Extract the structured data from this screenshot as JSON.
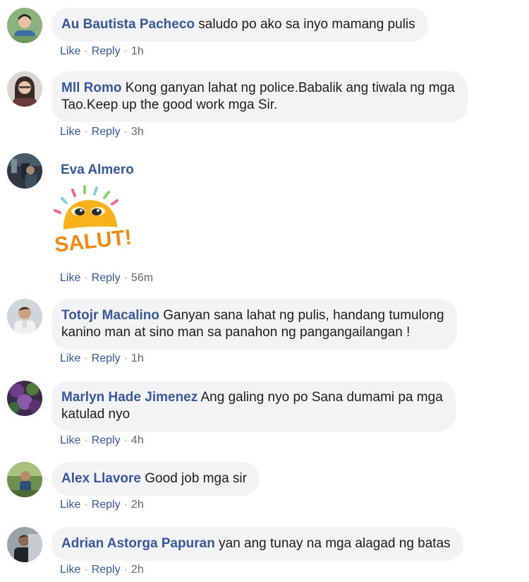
{
  "actions": {
    "like": "Like",
    "reply": "Reply",
    "separator": "·"
  },
  "comments": [
    {
      "name": "Au Bautista Pacheco",
      "text": "saludo po ako sa inyo mamang pulis",
      "time": "1h"
    },
    {
      "name": "Mll Romo",
      "text_line1": "Kong ganyan lahat ng police.Babalik ang tiwala ng mga",
      "text_line2": "Tao.Keep up the good work mga Sir.",
      "time": "3h"
    },
    {
      "name": "Eva Almero",
      "sticker_text": "SALUT!",
      "time": "56m"
    },
    {
      "name": "Totojr Macalino",
      "text_line1": "Ganyan sana lahat ng pulis, handang tumulong",
      "text_line2": "kanino man at sino man sa panahon ng pangangailangan !",
      "time": "1h"
    },
    {
      "name": "Marlyn Hade Jimenez",
      "text_line1": "Ang galing nyo po Sana dumami pa mga",
      "text_line2": "katulad nyo",
      "time": "4h"
    },
    {
      "name": "Alex Llavore",
      "text": "Good job mga sir",
      "time": "2h"
    },
    {
      "name": "Adrian Astorga Papuran",
      "text": "yan ang tunay na mga alagad ng batas",
      "time": "2h"
    }
  ],
  "colors": {
    "name": "#385898",
    "bubble": "#f2f3f5",
    "meta": "#616770",
    "sticker_sun": "#f7b21b",
    "sticker_text": "#ef8a14"
  }
}
